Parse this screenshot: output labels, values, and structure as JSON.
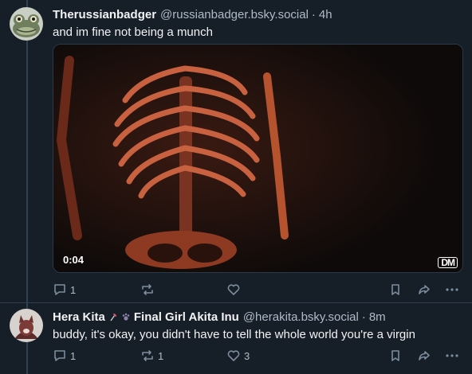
{
  "posts": [
    {
      "display_name": "Therussianbadger",
      "handle": "@russianbadger.bsky.social",
      "separator": "·",
      "time": "4h",
      "text": "and im fine not being a munch",
      "avatar_icon": "frog-avatar",
      "media": {
        "type": "video",
        "duration": "0:04",
        "watermark": "DM"
      },
      "actions": {
        "reply_count": "1",
        "repost_count": "",
        "like_count": ""
      }
    },
    {
      "display_name": "Hera Kita",
      "display_name_suffix": "Final Girl Akita Inu",
      "handle": "@herakita.bsky.social",
      "separator": "·",
      "time": "8m",
      "text": "buddy, it's okay, you didn't have to tell the whole world you're a virgin",
      "avatar_icon": "dog-avatar",
      "emoji_icons": [
        "axe-icon",
        "paw-icon"
      ],
      "actions": {
        "reply_count": "1",
        "repost_count": "1",
        "like_count": "3"
      }
    }
  ],
  "colors": {
    "background": "#161e27",
    "text": "#f1f3f5",
    "muted": "#aebbc9",
    "icon": "#7b8d9e",
    "thread_line": "#2e4052"
  }
}
